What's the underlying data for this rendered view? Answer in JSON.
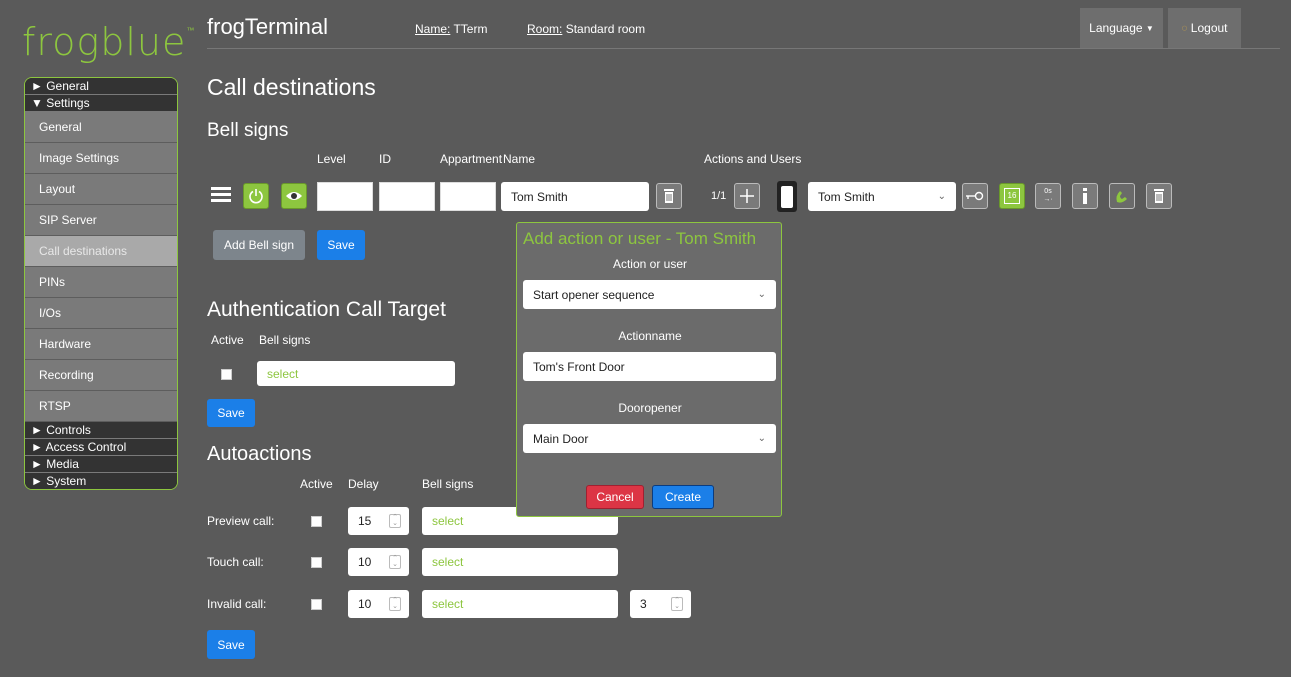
{
  "logo": "frogblue",
  "logo_tm": "™",
  "header": {
    "title": "frogTerminal",
    "name_key": "Name:",
    "name_val": "TTerm",
    "room_key": "Room:",
    "room_val": "Standard room",
    "language": "Language",
    "logout": "Logout"
  },
  "sidebar": {
    "general_section": "General",
    "settings_section": "Settings",
    "items": [
      "General",
      "Image Settings",
      "Layout",
      "SIP Server",
      "Call destinations",
      "PINs",
      "I/Os",
      "Hardware",
      "Recording",
      "RTSP"
    ],
    "controls_section": "Controls",
    "access_section": "Access Control",
    "media_section": "Media",
    "system_section": "System"
  },
  "main": {
    "title": "Call destinations",
    "bell_title": "Bell signs",
    "cols": {
      "level": "Level",
      "id": "ID",
      "appartment": "Appartment",
      "name": "Name",
      "actions": "Actions and Users"
    },
    "bell_row": {
      "name": "Tom Smith",
      "page": "1/1",
      "user": "Tom Smith",
      "calendar_day": "16",
      "delay_label": "0s"
    },
    "add_bell": "Add Bell sign",
    "save": "Save",
    "auth_title": "Authentication Call Target",
    "auth_active": "Active",
    "auth_bellsigns": "Bell signs",
    "auth_select": "select",
    "auto_title": "Autoactions",
    "auto_cols": {
      "active": "Active",
      "delay": "Delay",
      "bellsigns": "Bell signs"
    },
    "auto_rows": [
      {
        "label": "Preview call:",
        "delay": "15",
        "select": "select"
      },
      {
        "label": "Touch call:",
        "delay": "10",
        "select": "select"
      },
      {
        "label": "Invalid call:",
        "delay": "10",
        "select": "select",
        "extra": "3"
      }
    ]
  },
  "modal": {
    "title": "Add action or user - Tom Smith",
    "action_label": "Action or user",
    "action_value": "Start opener sequence",
    "name_label": "Actionname",
    "name_value": "Tom's Front Door",
    "door_label": "Dooropener",
    "door_value": "Main Door",
    "cancel": "Cancel",
    "create": "Create"
  },
  "colors": {
    "brand_green": "#8dc63f",
    "primary_blue": "#1b7fe8",
    "cancel_red": "#dc3545",
    "background": "#5a5a5a"
  }
}
